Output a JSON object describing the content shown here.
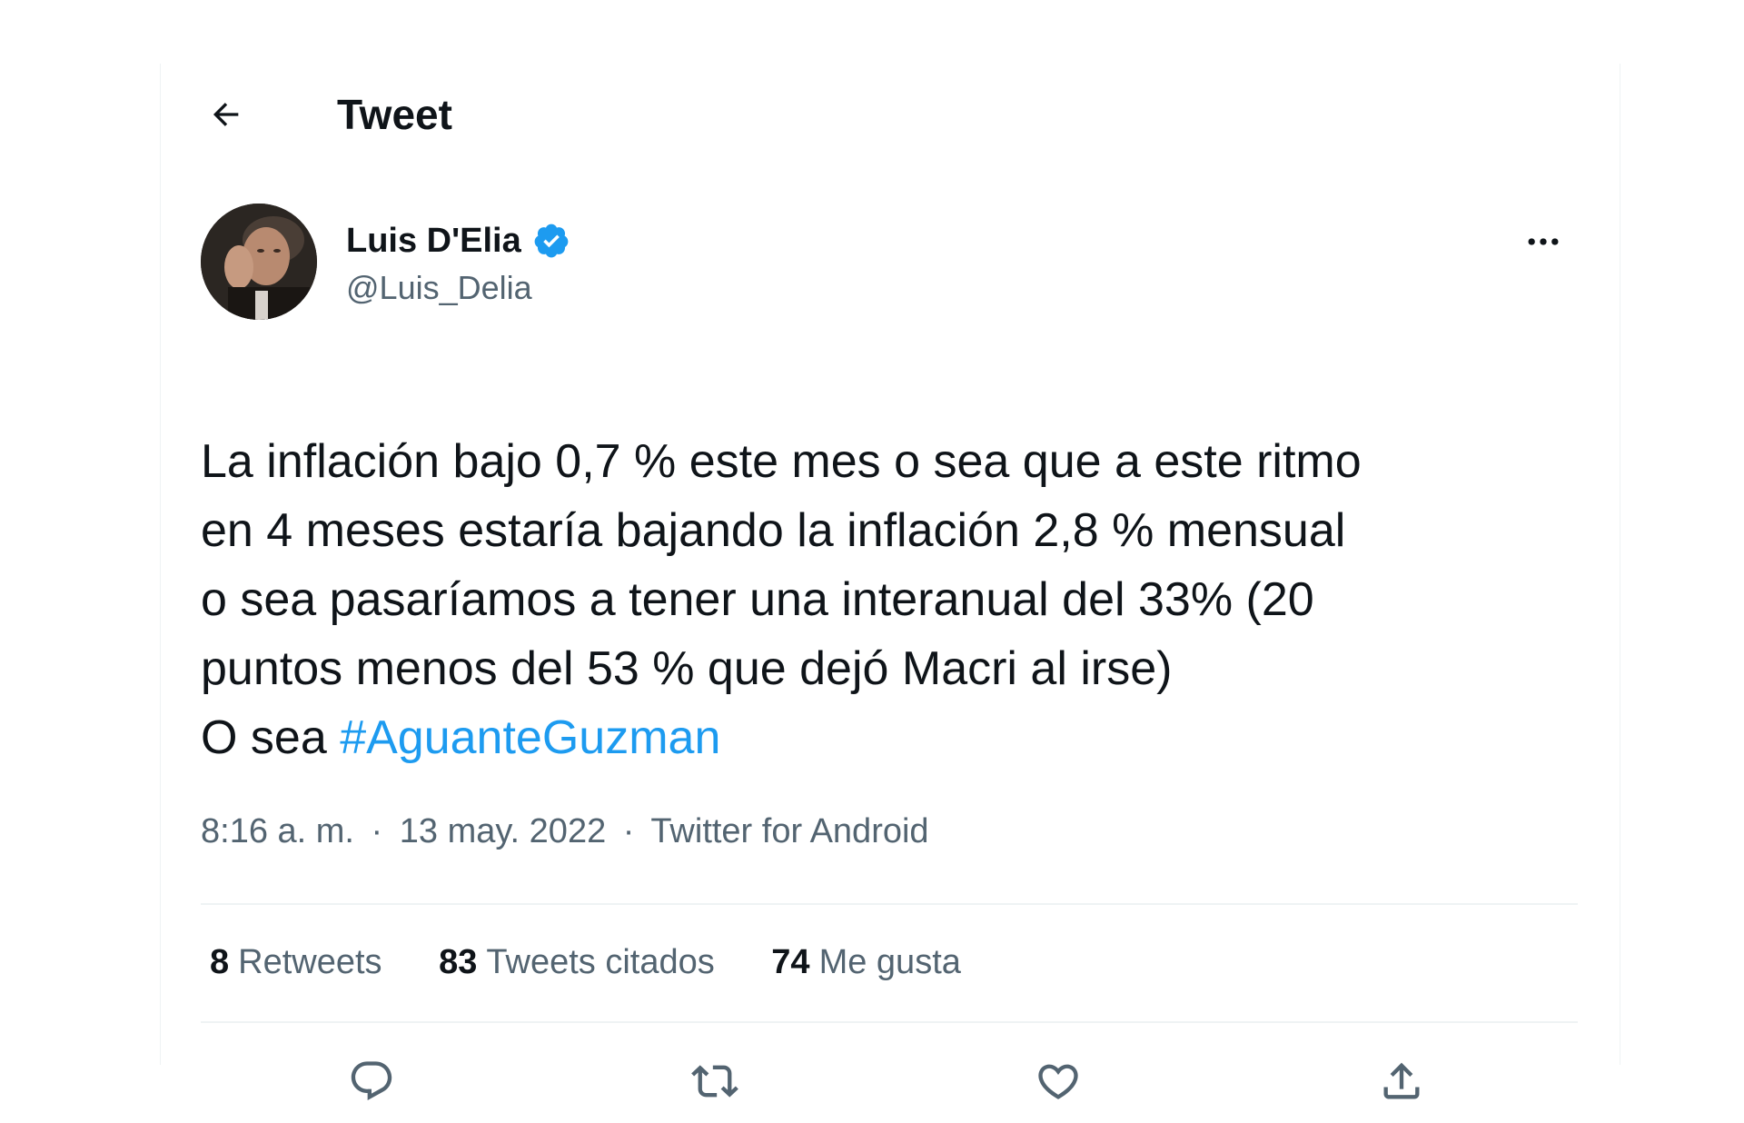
{
  "header": {
    "title": "Tweet",
    "back_icon": "arrow-left-icon"
  },
  "author": {
    "display_name": "Luis D'Elia",
    "handle": "@Luis_Delia",
    "verified": true
  },
  "tweet": {
    "lines": [
      "La inflación bajo 0,7 % este mes o sea que a este ritmo",
      "en 4 meses estaría bajando la inflación 2,8 % mensual",
      "o sea pasaríamos a tener una interanual del 33% (20",
      "puntos menos del 53 % que dejó Macri al irse)"
    ],
    "last_line_prefix": "O sea ",
    "hashtag": "#AguanteGuzman"
  },
  "meta": {
    "time": "8:16 a. m.",
    "separator": "·",
    "date": "13 may. 2022",
    "source": "Twitter for Android"
  },
  "stats": {
    "retweets_count": "8",
    "retweets_label": "Retweets",
    "quotes_count": "83",
    "quotes_label": "Tweets citados",
    "likes_count": "74",
    "likes_label": "Me gusta"
  },
  "colors": {
    "accent": "#1d9bf0",
    "text_primary": "#0f1419",
    "text_secondary": "#536471",
    "divider": "#eff3f4"
  },
  "icons": {
    "reply": "reply-icon",
    "retweet": "retweet-icon",
    "like": "heart-icon",
    "share": "share-icon",
    "more": "more-icon",
    "verified": "verified-badge-icon"
  }
}
